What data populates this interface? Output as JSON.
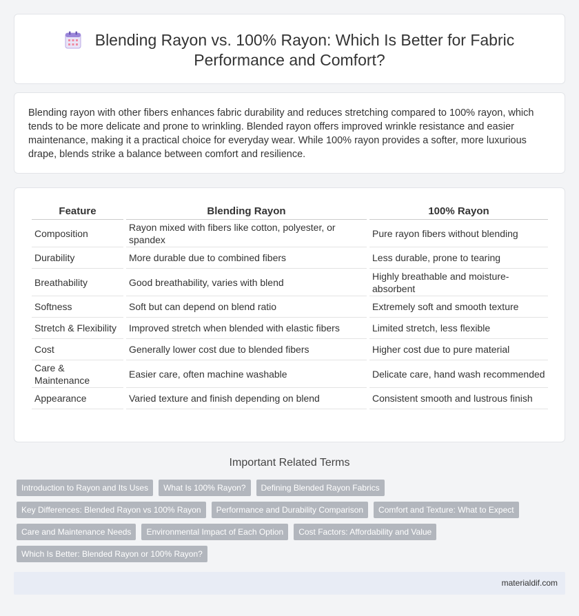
{
  "header": {
    "title_line1": "Blending Rayon vs. 100% Rayon: Which Is Better for Fabric",
    "title_line2": "Performance and Comfort?",
    "icon": "calendar-icon"
  },
  "intro": {
    "text": "Blending rayon with other fibers enhances fabric durability and reduces stretching compared to 100% rayon, which tends to be more delicate and prone to wrinkling. Blended rayon offers improved wrinkle resistance and easier maintenance, making it a practical choice for everyday wear. While 100% rayon provides a softer, more luxurious drape, blends strike a balance between comfort and resilience."
  },
  "table": {
    "headers": [
      "Feature",
      "Blending Rayon",
      "100% Rayon"
    ],
    "rows": [
      [
        "Composition",
        "Rayon mixed with fibers like cotton, polyester, or spandex",
        "Pure rayon fibers without blending"
      ],
      [
        "Durability",
        "More durable due to combined fibers",
        "Less durable, prone to tearing"
      ],
      [
        "Breathability",
        "Good breathability, varies with blend",
        "Highly breathable and moisture-absorbent"
      ],
      [
        "Softness",
        "Soft but can depend on blend ratio",
        "Extremely soft and smooth texture"
      ],
      [
        "Stretch & Flexibility",
        "Improved stretch when blended with elastic fibers",
        "Limited stretch, less flexible"
      ],
      [
        "Cost",
        "Generally lower cost due to blended fibers",
        "Higher cost due to pure material"
      ],
      [
        "Care & Maintenance",
        "Easier care, often machine washable",
        "Delicate care, hand wash recommended"
      ],
      [
        "Appearance",
        "Varied texture and finish depending on blend",
        "Consistent smooth and lustrous finish"
      ]
    ]
  },
  "terms": {
    "title": "Important Related Terms",
    "rows": [
      [
        "Introduction to Rayon and Its Uses",
        "What Is 100% Rayon?",
        "Defining Blended Rayon Fabrics"
      ],
      [
        "Key Differences: Blended Rayon vs 100% Rayon",
        "Performance and Durability Comparison",
        "Comfort and Texture: What to Expect"
      ],
      [
        "Care and Maintenance Needs",
        "Environmental Impact of Each Option",
        "Cost Factors: Affordability and Value"
      ],
      [
        "Which Is Better: Blended Rayon or 100% Rayon?"
      ]
    ]
  },
  "footer": {
    "site": "materialdif.com"
  },
  "colors": {
    "tag_bg": "#b2b6bd",
    "footer_bg": "#e8ecf5",
    "page_bg": "#f3f4f6"
  }
}
